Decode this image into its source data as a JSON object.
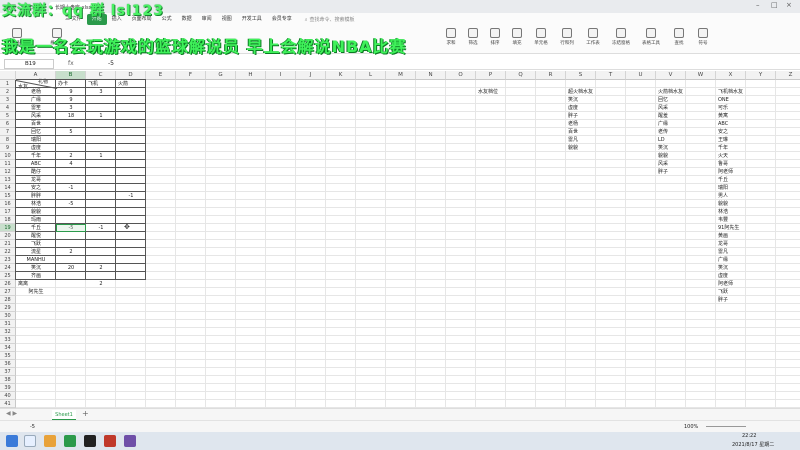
{
  "window": {
    "tabs": [
      "首页",
      "工作簿",
      "长期小盘座.xlsx"
    ],
    "controls": [
      "–",
      "□",
      "×"
    ]
  },
  "overlay": {
    "top_text": "交流群：qq 群 lsl123",
    "banner_text": "我是一名会玩游戏的篮球解说员 早上会解说NBA比赛"
  },
  "menu": {
    "items": [
      "三 文件",
      "开始",
      "插入",
      "页面布局",
      "公式",
      "数据",
      "审阅",
      "视图",
      "开发工具",
      "会员专享"
    ],
    "active_index": 1,
    "search_placeholder": "查找命令、搜索模板"
  },
  "ribbon": {
    "buttons": [
      "粘贴",
      "格式刷",
      "",
      "",
      "",
      "",
      "",
      "",
      "",
      "",
      "",
      "",
      "",
      "",
      "",
      "",
      "求和",
      "筛选",
      "排序",
      "填充",
      "单元格",
      "行和列",
      "工作表",
      "冻结窗格",
      "表格工具",
      "查找",
      "符号"
    ]
  },
  "formula": {
    "name_box": "B19",
    "fx": "fx",
    "value": "-5"
  },
  "columns": [
    "A",
    "B",
    "C",
    "D",
    "E",
    "F",
    "G",
    "H",
    "I",
    "J",
    "K",
    "L",
    "M",
    "N",
    "O",
    "P",
    "Q",
    "R",
    "S",
    "T",
    "U",
    "V",
    "W",
    "X",
    "Y",
    "Z"
  ],
  "rows": [
    "1",
    "2",
    "3",
    "4",
    "5",
    "6",
    "7",
    "8",
    "9",
    "10",
    "11",
    "12",
    "13",
    "14",
    "15",
    "16",
    "17",
    "18",
    "19",
    "20",
    "21",
    "22",
    "23",
    "24",
    "25",
    "26",
    "27",
    "28",
    "29",
    "30",
    "31",
    "32",
    "33",
    "34",
    "35",
    "36",
    "37",
    "38",
    "39",
    "40",
    "41",
    "42"
  ],
  "selected": {
    "col": "B",
    "row": "19"
  },
  "table": {
    "header_a_top": "礼物",
    "header_a_bottom": "水友",
    "headers": [
      "办卡",
      "飞机",
      "火箭"
    ],
    "rows": [
      [
        "老杨",
        "9",
        "3",
        ""
      ],
      [
        "广缘",
        "9",
        "",
        ""
      ],
      [
        "雷笙",
        "3",
        "",
        ""
      ],
      [
        "风采",
        "18",
        "1",
        ""
      ],
      [
        "百世",
        "",
        "",
        ""
      ],
      [
        "回忆",
        "5",
        "",
        ""
      ],
      [
        "瑞阳",
        "",
        "",
        ""
      ],
      [
        "虚度",
        "",
        "",
        ""
      ],
      [
        "千年",
        "2",
        "1",
        ""
      ],
      [
        "ABC",
        "4",
        "",
        ""
      ],
      [
        "酷仔",
        "",
        "",
        ""
      ],
      [
        "龙哥",
        "",
        "",
        ""
      ],
      [
        "安之",
        "-1",
        "",
        ""
      ],
      [
        "胖胖",
        "",
        "",
        "-1"
      ],
      [
        "林浩",
        "-5",
        "",
        ""
      ],
      [
        "貌貌",
        "",
        "",
        ""
      ],
      [
        "玛雨",
        "",
        "",
        ""
      ],
      [
        "千丘",
        "-5",
        "-1",
        ""
      ],
      [
        "醒悦",
        "",
        "",
        ""
      ],
      [
        "飞跃",
        "",
        "",
        ""
      ],
      [
        "流星",
        "2",
        "",
        ""
      ],
      [
        "MANHU",
        "",
        "",
        ""
      ],
      [
        "笑沉",
        "20",
        "2",
        ""
      ],
      [
        "齐画",
        "",
        "",
        ""
      ]
    ],
    "row26_a": "离离",
    "row26_c": "2",
    "row27_a": "阿先生"
  },
  "side_lists": {
    "p_header": "水友档位",
    "s_header": "超火档水友",
    "s_items": [
      "笑沉",
      "虚度",
      "胖子",
      "老杨",
      "百世",
      "雷凡",
      "貌貌"
    ],
    "v_header": "火箭档水友",
    "v_items": [
      "回忆",
      "风采",
      "醒羞",
      "广缘",
      "老传",
      "LD",
      "笑沉",
      "貌貌",
      "风采",
      "胖子"
    ],
    "x_header": "飞机档水友",
    "x_items": [
      "ONE",
      "可乐",
      "黄寓",
      "ABC",
      "安之",
      "王琳",
      "千年",
      "火天",
      "鲁哥",
      "阿老师",
      "千丘",
      "瑞阳",
      "男人",
      "貌貌",
      "林浩",
      "韦豐",
      "91阿先生",
      "黄画",
      "龙哥",
      "雷凡",
      "广缘",
      "笑沉",
      "虚度",
      "阿老师",
      "飞跃",
      "胖子"
    ]
  },
  "sheet_tabs": {
    "active": "Sheet1",
    "add": "+"
  },
  "status": {
    "left": "-5",
    "zoom": "100%"
  },
  "taskbar": {
    "time": "22:22",
    "date": "2021/8/17 星期二"
  }
}
